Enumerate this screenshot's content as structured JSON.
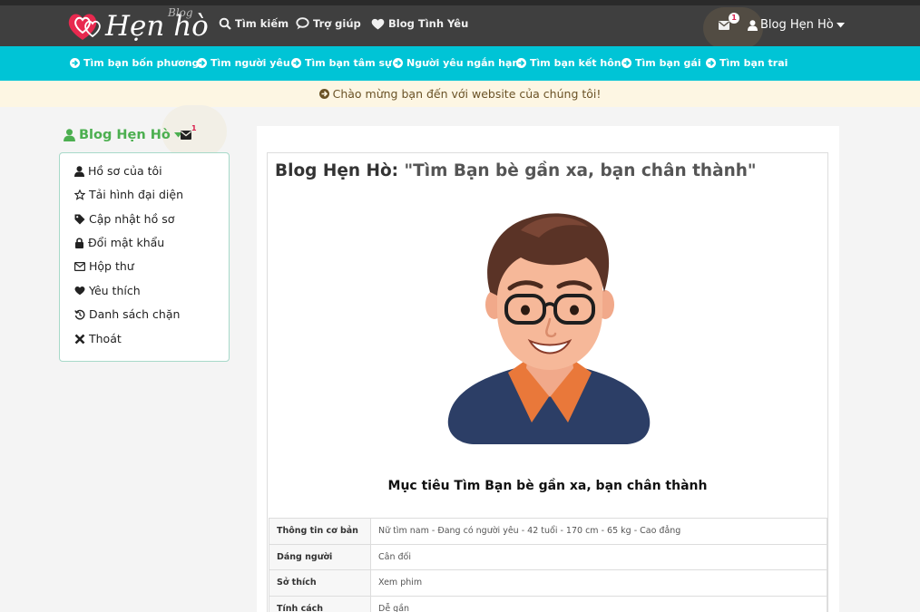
{
  "header": {
    "logo_text": "Hẹn hò",
    "logo_superscript": "Blog",
    "nav": [
      {
        "label": "Tìm kiếm",
        "icon": "search-icon"
      },
      {
        "label": "Trợ giúp",
        "icon": "comment-icon"
      },
      {
        "label": "Blog Tình Yêu",
        "icon": "heart-icon"
      }
    ],
    "mail_badge": "1",
    "user_label": "Blog Hẹn Hò"
  },
  "subnav": [
    {
      "label": "Tìm bạn bốn phương"
    },
    {
      "label": "Tìm người yêu"
    },
    {
      "label": "Tìm bạn tâm sự"
    },
    {
      "label": "Người yêu ngắn hạn"
    },
    {
      "label": "Tìm bạn kết hôn"
    },
    {
      "label": "Tìm bạn gái"
    },
    {
      "label": "Tìm bạn trai"
    }
  ],
  "welcome_text": "Chào mừng bạn đến với website của chúng tôi!",
  "sidebar": {
    "title": "Blog Hẹn Hò",
    "mail_badge": "1",
    "items": [
      {
        "label": "Hồ sơ của tôi",
        "icon": "user-icon"
      },
      {
        "label": "Tải hình đại diện",
        "icon": "star-icon"
      },
      {
        "label": "Cập nhật hồ sơ",
        "icon": "tag-icon"
      },
      {
        "label": "Đổi mật khẩu",
        "icon": "lock-icon"
      },
      {
        "label": "Hộp thư",
        "icon": "envelope-icon"
      },
      {
        "label": "Yêu thích",
        "icon": "heart-icon"
      },
      {
        "label": "Danh sách chặn",
        "icon": "history-icon"
      },
      {
        "label": "Thoát",
        "icon": "close-icon"
      }
    ]
  },
  "profile": {
    "name": "Blog Hẹn Hò:",
    "tagline": "\"Tìm Bạn bè gần xa, bạn chân thành\"",
    "goal": "Mục tiêu Tìm Bạn bè gần xa, bạn chân thành",
    "info": [
      {
        "key": "Thông tin cơ bản",
        "value": "Nữ tìm nam - Đang có người yêu - 42 tuổi - 170 cm - 65 kg - Cao đẳng"
      },
      {
        "key": "Dáng người",
        "value": "Cân đối"
      },
      {
        "key": "Sở thích",
        "value": "Xem phim"
      },
      {
        "key": "Tính cách",
        "value": "Dễ gần"
      }
    ]
  },
  "colors": {
    "navbar": "#3f3f3f",
    "subnav": "#00c4d6",
    "welcome_bg": "#fdf6e3",
    "sidebar_title": "#4caf50",
    "logo_heart": "#e8294f"
  }
}
